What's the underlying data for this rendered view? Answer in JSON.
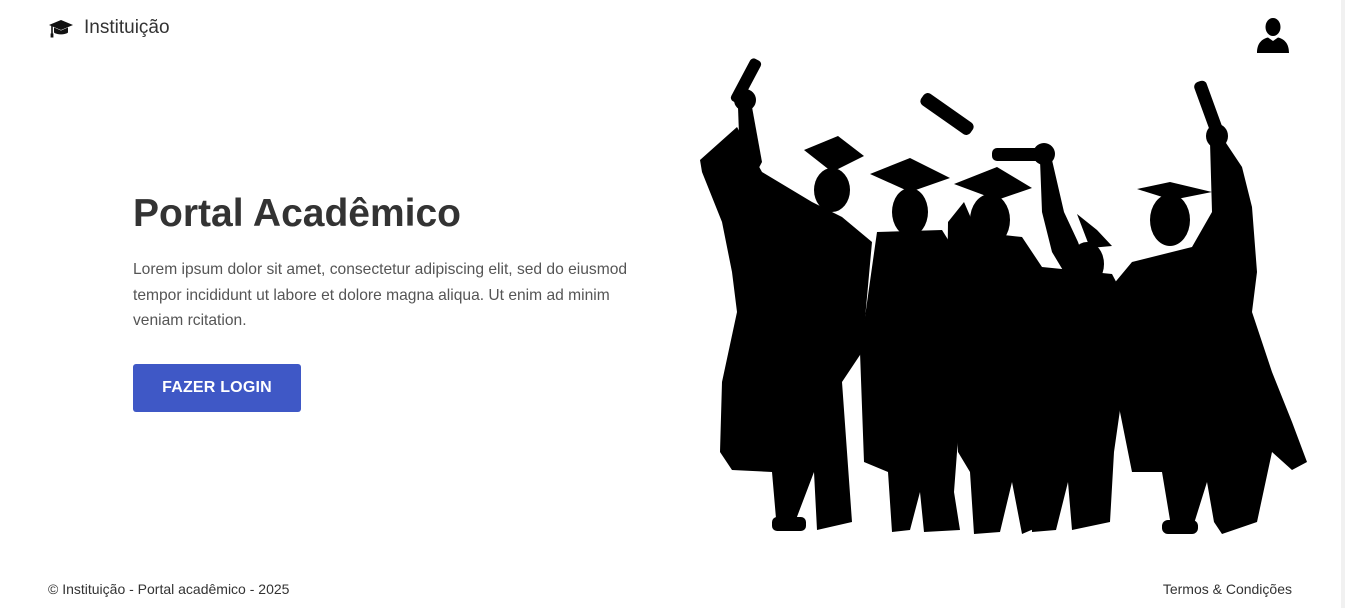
{
  "header": {
    "brand_icon": "graduation-cap-icon",
    "brand_name": "Instituição",
    "user_icon": "user-icon"
  },
  "hero": {
    "title": "Portal Acadêmico",
    "description": "Lorem ipsum dolor sit amet, consectetur adipiscing elit, sed do eiusmod tempor incididunt ut labore et dolore magna aliqua. Ut enim ad minim veniam rcitation.",
    "login_label": "FAZER LOGIN",
    "illustration_icon": "graduates-silhouette"
  },
  "footer": {
    "copyright": "© Instituição - Portal acadêmico - 2025",
    "terms_label": "Termos & Condições"
  },
  "colors": {
    "accent": "#3f58c6",
    "text_dark": "#333333",
    "text_body": "#555555",
    "background": "#ffffff",
    "silhouette": "#000000"
  }
}
